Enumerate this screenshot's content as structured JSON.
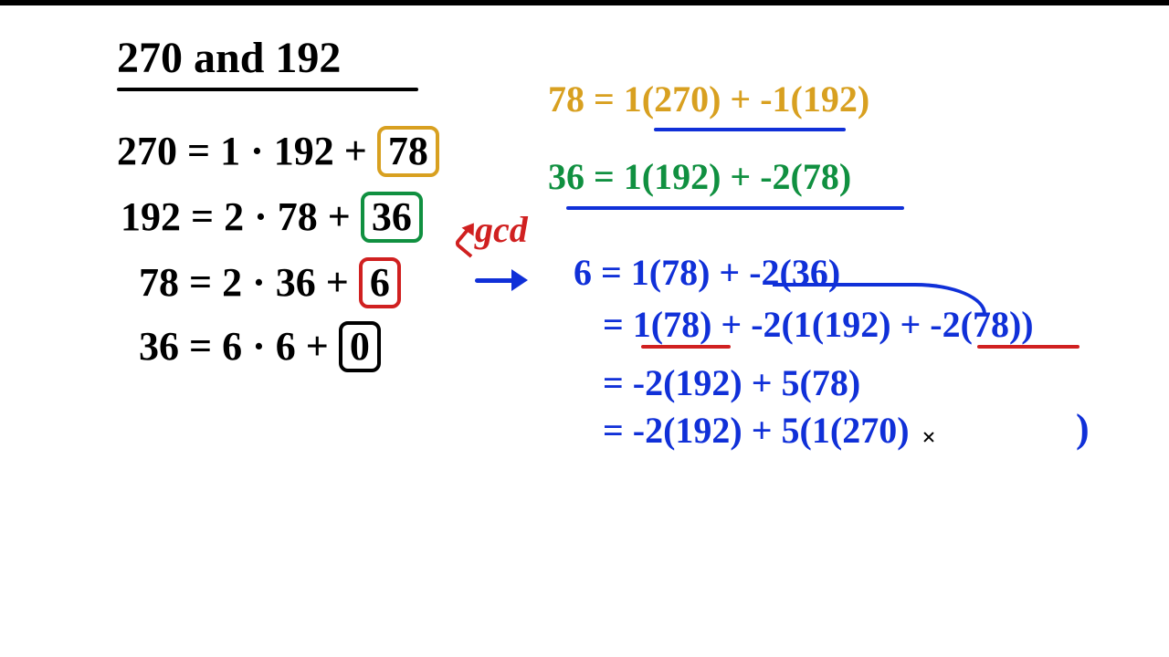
{
  "title": "270  and 192",
  "euclid": {
    "l1a": "270 = 1 · 192 + ",
    "l1b": "78",
    "l2a": "192 = 2 · 78  + ",
    "l2b": "36",
    "l3a": " 78 = 2 · 36  + ",
    "l3b": "6",
    "l4a": " 36 = 6 · 6   + ",
    "l4b": "0"
  },
  "gcd_label": "gcd",
  "subst": {
    "o1": "78 = 1(270) + -1(192)",
    "g1": "36 = 1(192) + -2(78)",
    "b1": "6 = 1(78) + -2(36)",
    "b2": "  = 1(78) + -2(1(192) + -2(78))",
    "b3": "  = -2(192) + 5(78)",
    "b4": "  = -2(192) + 5(1(270)",
    "paren": ")"
  }
}
